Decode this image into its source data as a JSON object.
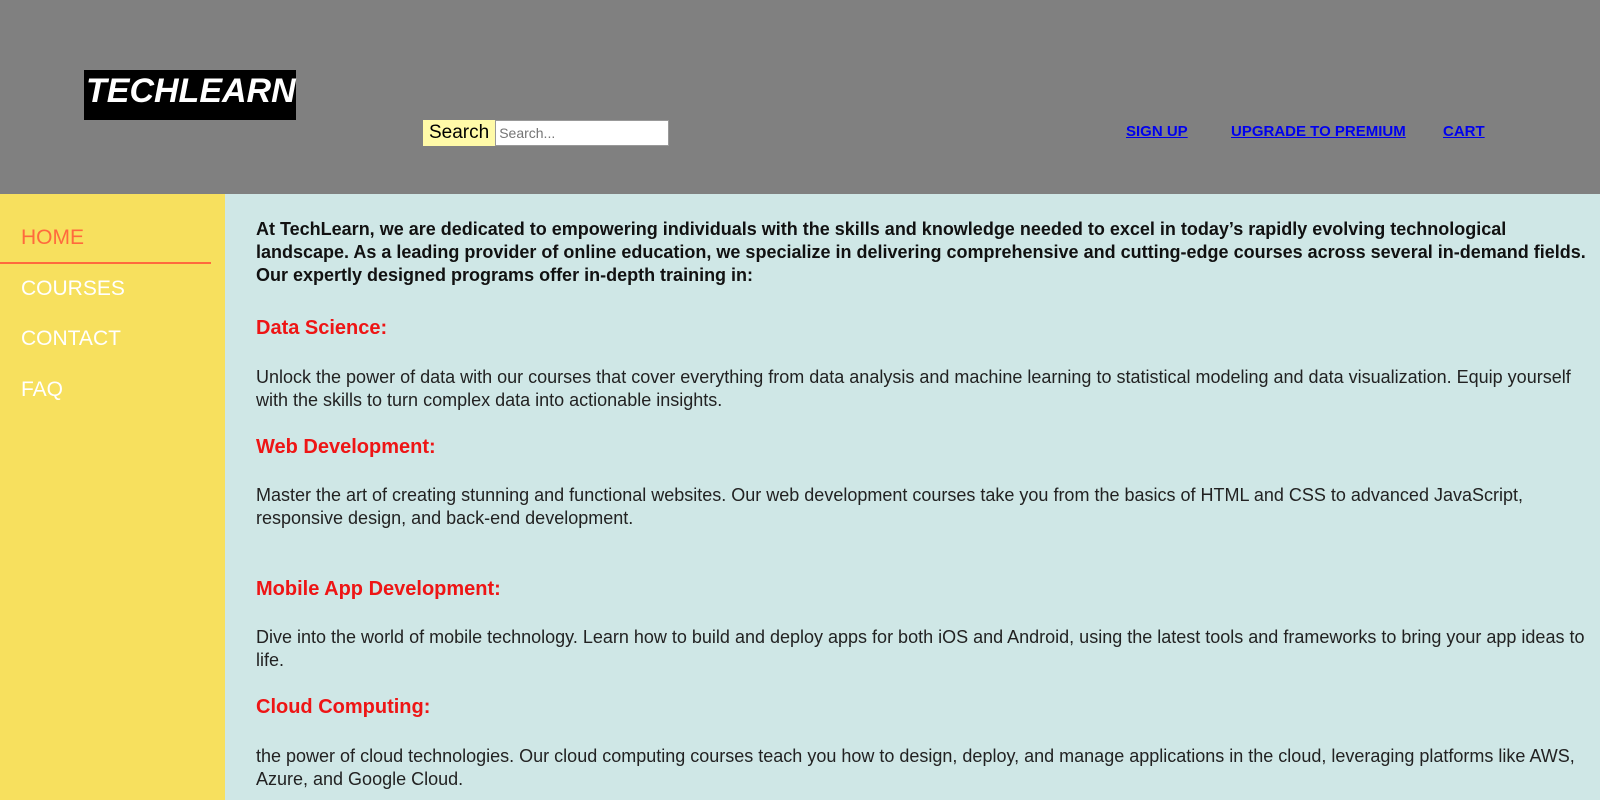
{
  "header": {
    "logo_text": "TECHLEARN",
    "search_label": "Search",
    "search_placeholder": "Search...",
    "search_value": "",
    "links": [
      "SIGN UP",
      "UPGRADE TO PREMIUM",
      "CART"
    ]
  },
  "sidebar": {
    "items": [
      {
        "label": "HOME",
        "active": true
      },
      {
        "label": "COURSES",
        "active": false
      },
      {
        "label": "CONTACT",
        "active": false
      },
      {
        "label": "FAQ",
        "active": false
      }
    ]
  },
  "main": {
    "intro": "At TechLearn, we are dedicated to empowering individuals with the skills and knowledge needed to excel in today’s rapidly evolving technological landscape. As a leading provider of online education, we specialize in delivering comprehensive and cutting-edge courses across several in-demand fields. Our expertly designed programs offer in-depth training in:",
    "sections": [
      {
        "heading": "Data Science:",
        "text": "Unlock the power of data with our courses that cover everything from data analysis and machine learning to statistical modeling and data visualization. Equip yourself with the skills to turn complex data into actionable insights."
      },
      {
        "heading": "Web Development:",
        "text": "Master the art of creating stunning and functional websites. Our web development courses take you from the basics of HTML and CSS to advanced JavaScript, responsive design, and back-end development."
      },
      {
        "heading": "Mobile App Development:",
        "text": "Dive into the world of mobile technology. Learn how to build and deploy apps for both iOS and Android, using the latest tools and frameworks to bring your app ideas to life."
      },
      {
        "heading": "Cloud Computing:",
        "text": "the power of cloud technologies. Our cloud computing courses teach you how to design, deploy, and manage applications in the cloud, leveraging platforms like AWS, Azure, and Google Cloud."
      }
    ]
  },
  "colors": {
    "header_bg": "#808080",
    "sidebar_bg": "#f7e05e",
    "content_bg": "#cfe7e6",
    "active_nav": "#ff6a3d",
    "heading": "#ee1515",
    "link": "#0000ee",
    "search_label_bg": "#fffaa8"
  }
}
